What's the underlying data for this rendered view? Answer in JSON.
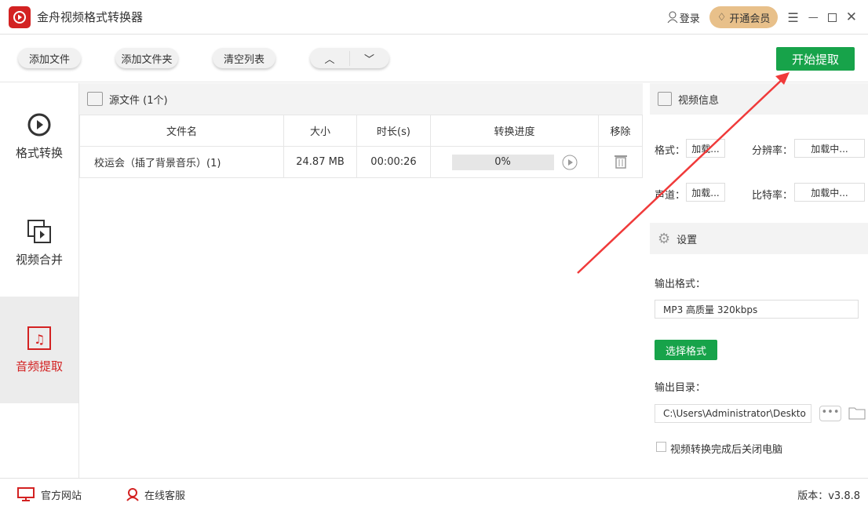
{
  "app": {
    "title": "金舟视频格式转换器",
    "login": "登录",
    "vip": "开通会员"
  },
  "toolbar": {
    "add_file": "添加文件",
    "add_folder": "添加文件夹",
    "clear": "清空列表",
    "start": "开始提取"
  },
  "sidebar": {
    "items": [
      {
        "label": "格式转换"
      },
      {
        "label": "视频合并"
      },
      {
        "label": "音频提取"
      }
    ]
  },
  "files": {
    "header": "源文件 (1个)",
    "columns": [
      "文件名",
      "大小",
      "时长(s)",
      "转换进度",
      "移除"
    ],
    "rows": [
      {
        "name": "校运会（插了背景音乐）(1)",
        "size": "24.87 MB",
        "duration": "00:00:26",
        "progress": "0%",
        "progress_value": 0
      }
    ]
  },
  "info": {
    "title": "视频信息",
    "format_label": "格式：",
    "format": "加载...",
    "resolution_label": "分辨率：",
    "resolution": "加载中...",
    "channel_label": "声道：",
    "channel": "加载...",
    "bitrate_label": "比特率：",
    "bitrate": "加载中..."
  },
  "settings": {
    "title": "设置",
    "output_format_label": "输出格式：",
    "output_format": "MP3 高质量 320kbps",
    "choose_format": "选择格式",
    "output_dir_label": "输出目录：",
    "output_dir": "C:\\Users\\Administrator\\Deskto",
    "shutdown": "视频转换完成后关闭电脑"
  },
  "footer": {
    "website": "官方网站",
    "support": "在线客服",
    "version": "版本：v3.8.8"
  }
}
